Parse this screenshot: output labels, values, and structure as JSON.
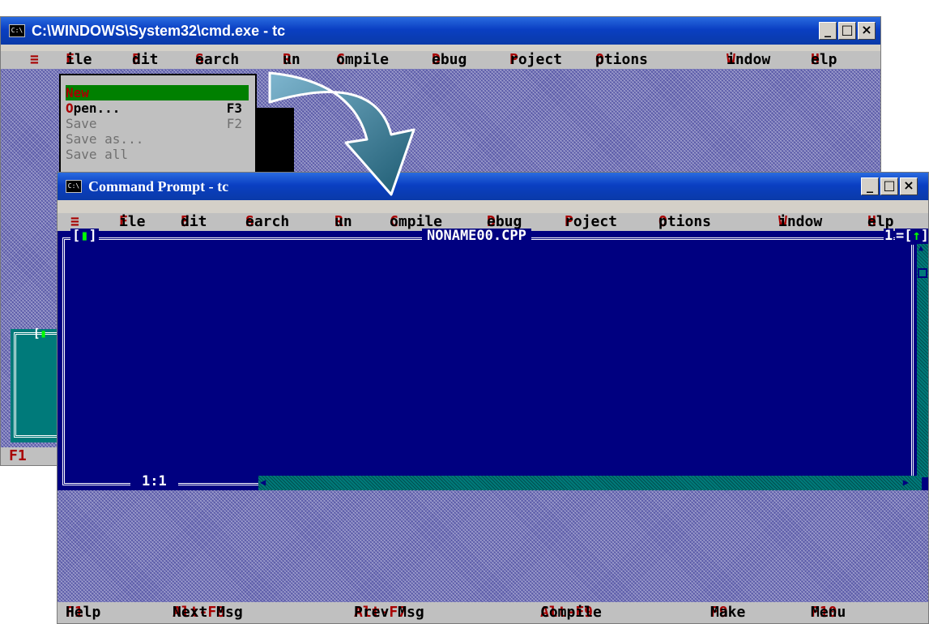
{
  "back_window": {
    "title": "C:\\WINDOWS\\System32\\cmd.exe - tc",
    "icon_text": "C:\\",
    "menu": [
      {
        "hot": "≡",
        "rest": ""
      },
      {
        "hot": "F",
        "rest": "ile"
      },
      {
        "hot": "E",
        "rest": "dit"
      },
      {
        "hot": "S",
        "rest": "earch"
      },
      {
        "hot": "R",
        "rest": "un"
      },
      {
        "hot": "C",
        "rest": "ompile"
      },
      {
        "hot": "D",
        "rest": "ebug"
      },
      {
        "hot": "P",
        "rest": "roject"
      },
      {
        "hot": "O",
        "rest": "ptions"
      },
      {
        "hot": "W",
        "rest": "indow"
      },
      {
        "hot": "H",
        "rest": "elp"
      }
    ],
    "file_menu": {
      "new": "New",
      "open": {
        "hot": "O",
        "rest": "pen...",
        "key": "F3"
      },
      "save": {
        "label": "Save",
        "key": "F2"
      },
      "save_as": "Save as...",
      "save_all": "Save all"
    },
    "status_f1": "F1",
    "colors": {
      "selected_menu": "#008000",
      "hotkey": "#a80000"
    }
  },
  "front_window": {
    "title": "Command Prompt - tc",
    "icon_text": "C:\\",
    "menu": [
      {
        "hot": "≡",
        "rest": ""
      },
      {
        "hot": "F",
        "rest": "ile"
      },
      {
        "hot": "E",
        "rest": "dit"
      },
      {
        "hot": "S",
        "rest": "earch"
      },
      {
        "hot": "R",
        "rest": "un"
      },
      {
        "hot": "C",
        "rest": "ompile"
      },
      {
        "hot": "D",
        "rest": "ebug"
      },
      {
        "hot": "P",
        "rest": "roject"
      },
      {
        "hot": "O",
        "rest": "ptions"
      },
      {
        "hot": "W",
        "rest": "indow"
      },
      {
        "hot": "H",
        "rest": "elp"
      }
    ],
    "editor": {
      "filename": "NONAME00.CPP",
      "window_number": "1",
      "close_box": "[▮]",
      "zoom_box": "[↑]",
      "position": "1:1"
    },
    "status": [
      {
        "key": "F1",
        "label": "Help"
      },
      {
        "key": "Alt-F8",
        "label": "Next Msg"
      },
      {
        "key": "Alt-F7",
        "label": "Prev Msg"
      },
      {
        "key": "Alt-F9",
        "label": "Compile"
      },
      {
        "key": "F9",
        "label": "Make"
      },
      {
        "key": "F10",
        "label": "Menu"
      }
    ],
    "colors": {
      "editor_bg": "#000080",
      "desktop": "#5a5aa8",
      "scrollbar": "#007a7a"
    }
  }
}
